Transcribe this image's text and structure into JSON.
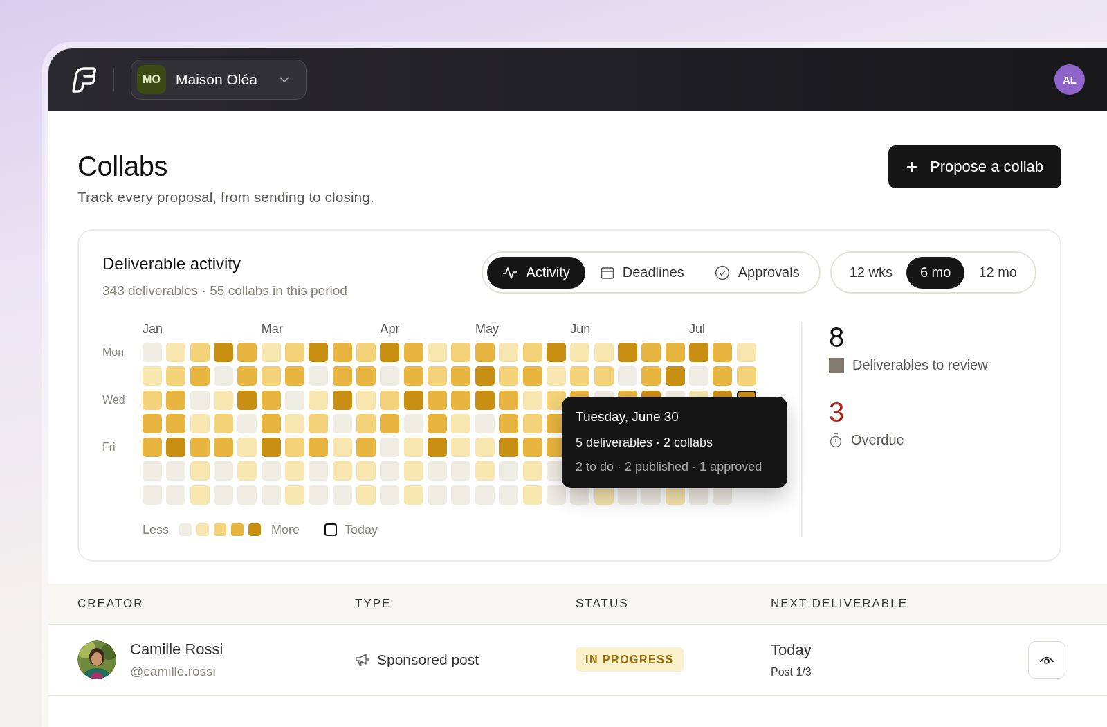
{
  "header": {
    "workspace": {
      "initials": "MO",
      "name": "Maison Oléa"
    },
    "user_initials": "AL"
  },
  "page": {
    "title": "Collabs",
    "subtitle": "Track every proposal, from sending to closing.",
    "primary_action": {
      "icon": "+",
      "label": "Propose a collab"
    }
  },
  "activity": {
    "title": "Deliverable activity",
    "summary": "343 deliverables · 55 collabs in this period",
    "views": [
      {
        "label": "Activity",
        "selected": true
      },
      {
        "label": "Deadlines",
        "selected": false
      },
      {
        "label": "Approvals",
        "selected": false
      }
    ],
    "ranges": [
      {
        "label": "12 wks",
        "selected": false
      },
      {
        "label": "6 mo",
        "selected": true
      },
      {
        "label": "12 mo",
        "selected": false
      }
    ],
    "months": [
      {
        "label": "Jan"
      },
      {
        "label": "Mar"
      },
      {
        "label": "Apr"
      },
      {
        "label": "May"
      },
      {
        "label": "Jun"
      },
      {
        "label": "Jul"
      }
    ],
    "days": [
      {
        "label": "Mon",
        "cells": [
          {
            "kind": "none",
            "today": false
          },
          {
            "kind": "low",
            "today": false
          },
          {
            "kind": "mid",
            "today": false
          },
          {
            "kind": "max",
            "today": false
          },
          {
            "kind": "high",
            "today": false
          },
          {
            "kind": "low",
            "today": false
          },
          {
            "kind": "mid",
            "today": false
          },
          {
            "kind": "max",
            "today": false
          },
          {
            "kind": "high",
            "today": false
          },
          {
            "kind": "mid",
            "today": false
          },
          {
            "kind": "max",
            "today": false
          },
          {
            "kind": "high",
            "today": false
          },
          {
            "kind": "low",
            "today": false
          },
          {
            "kind": "mid",
            "today": false
          },
          {
            "kind": "high",
            "today": false
          },
          {
            "kind": "low",
            "today": false
          },
          {
            "kind": "mid",
            "today": false
          },
          {
            "kind": "max",
            "today": false
          },
          {
            "kind": "low",
            "today": false
          },
          {
            "kind": "low",
            "today": false
          },
          {
            "kind": "max",
            "today": false
          },
          {
            "kind": "high",
            "today": false
          },
          {
            "kind": "high",
            "today": false
          },
          {
            "kind": "max",
            "today": false
          },
          {
            "kind": "high",
            "today": false
          },
          {
            "kind": "low",
            "today": false
          }
        ]
      },
      {
        "cells": [
          {
            "kind": "low",
            "today": false
          },
          {
            "kind": "mid",
            "today": false
          },
          {
            "kind": "high",
            "today": false
          },
          {
            "kind": "none",
            "today": false
          },
          {
            "kind": "high",
            "today": false
          },
          {
            "kind": "mid",
            "today": false
          },
          {
            "kind": "high",
            "today": false
          },
          {
            "kind": "none",
            "today": false
          },
          {
            "kind": "high",
            "today": false
          },
          {
            "kind": "high",
            "today": false
          },
          {
            "kind": "none",
            "today": false
          },
          {
            "kind": "high",
            "today": false
          },
          {
            "kind": "mid",
            "today": false
          },
          {
            "kind": "high",
            "today": false
          },
          {
            "kind": "max",
            "today": false
          },
          {
            "kind": "mid",
            "today": false
          },
          {
            "kind": "high",
            "today": false
          },
          {
            "kind": "low",
            "today": false
          },
          {
            "kind": "mid",
            "today": false
          },
          {
            "kind": "mid",
            "today": false
          },
          {
            "kind": "none",
            "today": false
          },
          {
            "kind": "high",
            "today": false
          },
          {
            "kind": "max",
            "today": false
          },
          {
            "kind": "none",
            "today": false
          },
          {
            "kind": "high",
            "today": false
          },
          {
            "kind": "mid",
            "today": false
          }
        ]
      },
      {
        "label": "Wed",
        "cells": [
          {
            "kind": "mid",
            "today": false
          },
          {
            "kind": "high",
            "today": false
          },
          {
            "kind": "none",
            "today": false
          },
          {
            "kind": "low",
            "today": false
          },
          {
            "kind": "max",
            "today": false
          },
          {
            "kind": "high",
            "today": false
          },
          {
            "kind": "none",
            "today": false
          },
          {
            "kind": "low",
            "today": false
          },
          {
            "kind": "max",
            "today": false
          },
          {
            "kind": "low",
            "today": false
          },
          {
            "kind": "mid",
            "today": false
          },
          {
            "kind": "max",
            "today": false
          },
          {
            "kind": "high",
            "today": false
          },
          {
            "kind": "high",
            "today": false
          },
          {
            "kind": "max",
            "today": false
          },
          {
            "kind": "high",
            "today": false
          },
          {
            "kind": "low",
            "today": false
          },
          {
            "kind": "mid",
            "today": false
          },
          {
            "kind": "high",
            "today": false
          },
          {
            "kind": "none",
            "today": false
          },
          {
            "kind": "high",
            "today": false
          },
          {
            "kind": "max",
            "today": false
          },
          {
            "kind": "none",
            "today": false
          },
          {
            "kind": "low",
            "today": false
          },
          {
            "kind": "max",
            "today": false
          },
          {
            "kind": "max",
            "today": true
          }
        ]
      },
      {
        "cells": [
          {
            "kind": "high",
            "today": false
          },
          {
            "kind": "high",
            "today": false
          },
          {
            "kind": "low",
            "today": false
          },
          {
            "kind": "mid",
            "today": false
          },
          {
            "kind": "none",
            "today": false
          },
          {
            "kind": "high",
            "today": false
          },
          {
            "kind": "low",
            "today": false
          },
          {
            "kind": "mid",
            "today": false
          },
          {
            "kind": "none",
            "today": false
          },
          {
            "kind": "mid",
            "today": false
          },
          {
            "kind": "high",
            "today": false
          },
          {
            "kind": "none",
            "today": false
          },
          {
            "kind": "high",
            "today": false
          },
          {
            "kind": "low",
            "today": false
          },
          {
            "kind": "none",
            "today": false
          },
          {
            "kind": "high",
            "today": false
          },
          {
            "kind": "mid",
            "today": false
          },
          {
            "kind": "high",
            "today": false
          }
        ]
      },
      {
        "label": "Fri",
        "cells": [
          {
            "kind": "high",
            "today": false
          },
          {
            "kind": "max",
            "today": false
          },
          {
            "kind": "high",
            "today": false
          },
          {
            "kind": "high",
            "today": false
          },
          {
            "kind": "low",
            "today": false
          },
          {
            "kind": "max",
            "today": false
          },
          {
            "kind": "mid",
            "today": false
          },
          {
            "kind": "high",
            "today": false
          },
          {
            "kind": "low",
            "today": false
          },
          {
            "kind": "high",
            "today": false
          },
          {
            "kind": "none",
            "today": false
          },
          {
            "kind": "low",
            "today": false
          },
          {
            "kind": "max",
            "today": false
          },
          {
            "kind": "low",
            "today": false
          },
          {
            "kind": "low",
            "today": false
          },
          {
            "kind": "max",
            "today": false
          },
          {
            "kind": "high",
            "today": false
          },
          {
            "kind": "high",
            "today": false
          }
        ]
      },
      {
        "cells": [
          {
            "kind": "none",
            "today": false
          },
          {
            "kind": "none",
            "today": false
          },
          {
            "kind": "low",
            "today": false
          },
          {
            "kind": "none",
            "today": false
          },
          {
            "kind": "low",
            "today": false
          },
          {
            "kind": "none",
            "today": false
          },
          {
            "kind": "low",
            "today": false
          },
          {
            "kind": "none",
            "today": false
          },
          {
            "kind": "low",
            "today": false
          },
          {
            "kind": "low",
            "today": false
          },
          {
            "kind": "none",
            "today": false
          },
          {
            "kind": "low",
            "today": false
          },
          {
            "kind": "none",
            "today": false
          },
          {
            "kind": "none",
            "today": false
          },
          {
            "kind": "low",
            "today": false
          },
          {
            "kind": "none",
            "today": false
          },
          {
            "kind": "low",
            "today": false
          },
          {
            "kind": "none",
            "today": false
          }
        ]
      },
      {
        "cells": [
          {
            "kind": "none",
            "today": false
          },
          {
            "kind": "none",
            "today": false
          },
          {
            "kind": "low",
            "today": false
          },
          {
            "kind": "none",
            "today": false
          },
          {
            "kind": "none",
            "today": false
          },
          {
            "kind": "none",
            "today": false
          },
          {
            "kind": "low",
            "today": false
          },
          {
            "kind": "none",
            "today": false
          },
          {
            "kind": "none",
            "today": false
          },
          {
            "kind": "low",
            "today": false
          },
          {
            "kind": "none",
            "today": false
          },
          {
            "kind": "low",
            "today": false
          },
          {
            "kind": "none",
            "today": false
          },
          {
            "kind": "none",
            "today": false
          },
          {
            "kind": "none",
            "today": false
          },
          {
            "kind": "none",
            "today": false
          },
          {
            "kind": "low",
            "today": false
          },
          {
            "kind": "none",
            "today": false
          },
          {
            "kind": "none",
            "today": false
          },
          {
            "kind": "low",
            "today": false
          },
          {
            "kind": "none",
            "today": false
          },
          {
            "kind": "none",
            "today": false
          },
          {
            "kind": "low",
            "today": false
          },
          {
            "kind": "none",
            "today": false
          },
          {
            "kind": "none",
            "today": false
          }
        ]
      }
    ],
    "tooltip": {
      "title": "Tuesday, June 30",
      "line_1": "5 deliverables · 2 collabs",
      "line_2": "2 to do · 2 published · 1 approved"
    },
    "legend": {
      "less": "Less",
      "more": "More",
      "today": "Today"
    },
    "stats": [
      {
        "value": "8",
        "label": "Deliverables to review",
        "kind": "review",
        "color": "#837a6e"
      },
      {
        "value": "3",
        "label": "Overdue",
        "kind": "overdue",
        "color": "#b42318"
      }
    ]
  },
  "table": {
    "columns": [
      "CREATOR",
      "TYPE",
      "STATUS",
      "NEXT DELIVERABLE"
    ],
    "rows": [
      {
        "name": "Camille Rossi",
        "handle": "@camille.rossi",
        "type": "Sponsored post",
        "status": "IN PROGRESS",
        "next": "Today",
        "next_detail": "Post 1/3"
      }
    ]
  }
}
